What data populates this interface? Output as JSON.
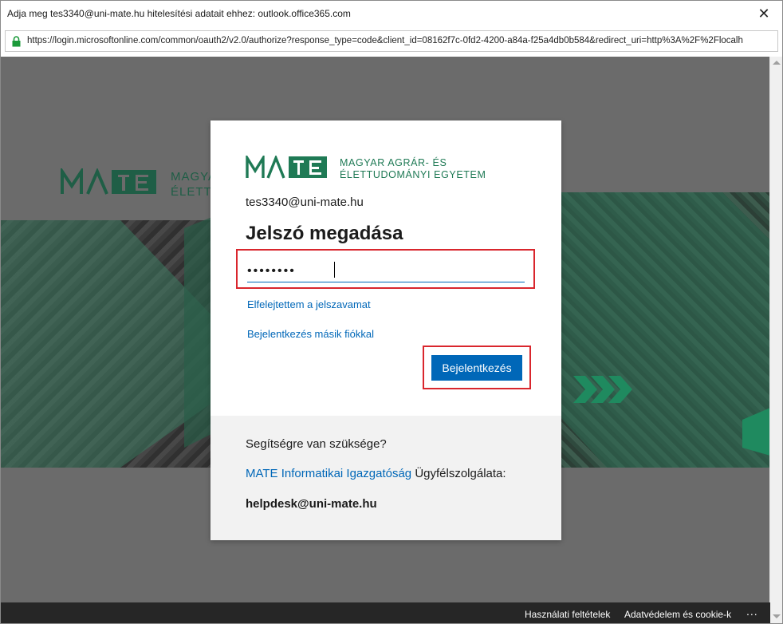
{
  "window": {
    "title": "Adja meg tes3340@uni-mate.hu hitelesítési adatait ehhez: outlook.office365.com",
    "close_glyph": "✕",
    "url": "https://login.microsoftonline.com/common/oauth2/v2.0/authorize?response_type=code&client_id=08162f7c-0fd2-4200-a84a-f25a4db0b584&redirect_uri=http%3A%2F%2Flocalh"
  },
  "background": {
    "logo_text_line1": "MAGYAR",
    "logo_text_line2": "ÉLETTUDOM"
  },
  "card": {
    "logo_line1": "MAGYAR AGRÁR- ÉS",
    "logo_line2": "ÉLETTUDOMÁNYI EGYETEM",
    "email": "tes3340@uni-mate.hu",
    "heading": "Jelszó megadása",
    "password_value": "password",
    "forgot_link": "Elfelejtettem a jelszavamat",
    "other_account_link": "Bejelentkezés másik fiókkal",
    "signin_button": "Bejelentkezés"
  },
  "help": {
    "question": "Segítségre van szüksége?",
    "link": "MATE Informatikai Igazgatóság",
    "link_suffix": " Ügyfélszolgálata:",
    "email": "helpdesk@uni-mate.hu"
  },
  "footer": {
    "terms": "Használati feltételek",
    "privacy": "Adatvédelem és cookie-k",
    "more": "..."
  },
  "colors": {
    "accent": "#0067b8",
    "highlight": "#d9262d",
    "mate_green": "#1f7a55"
  },
  "icons": {
    "lock": "lock-icon",
    "close": "close-icon"
  }
}
